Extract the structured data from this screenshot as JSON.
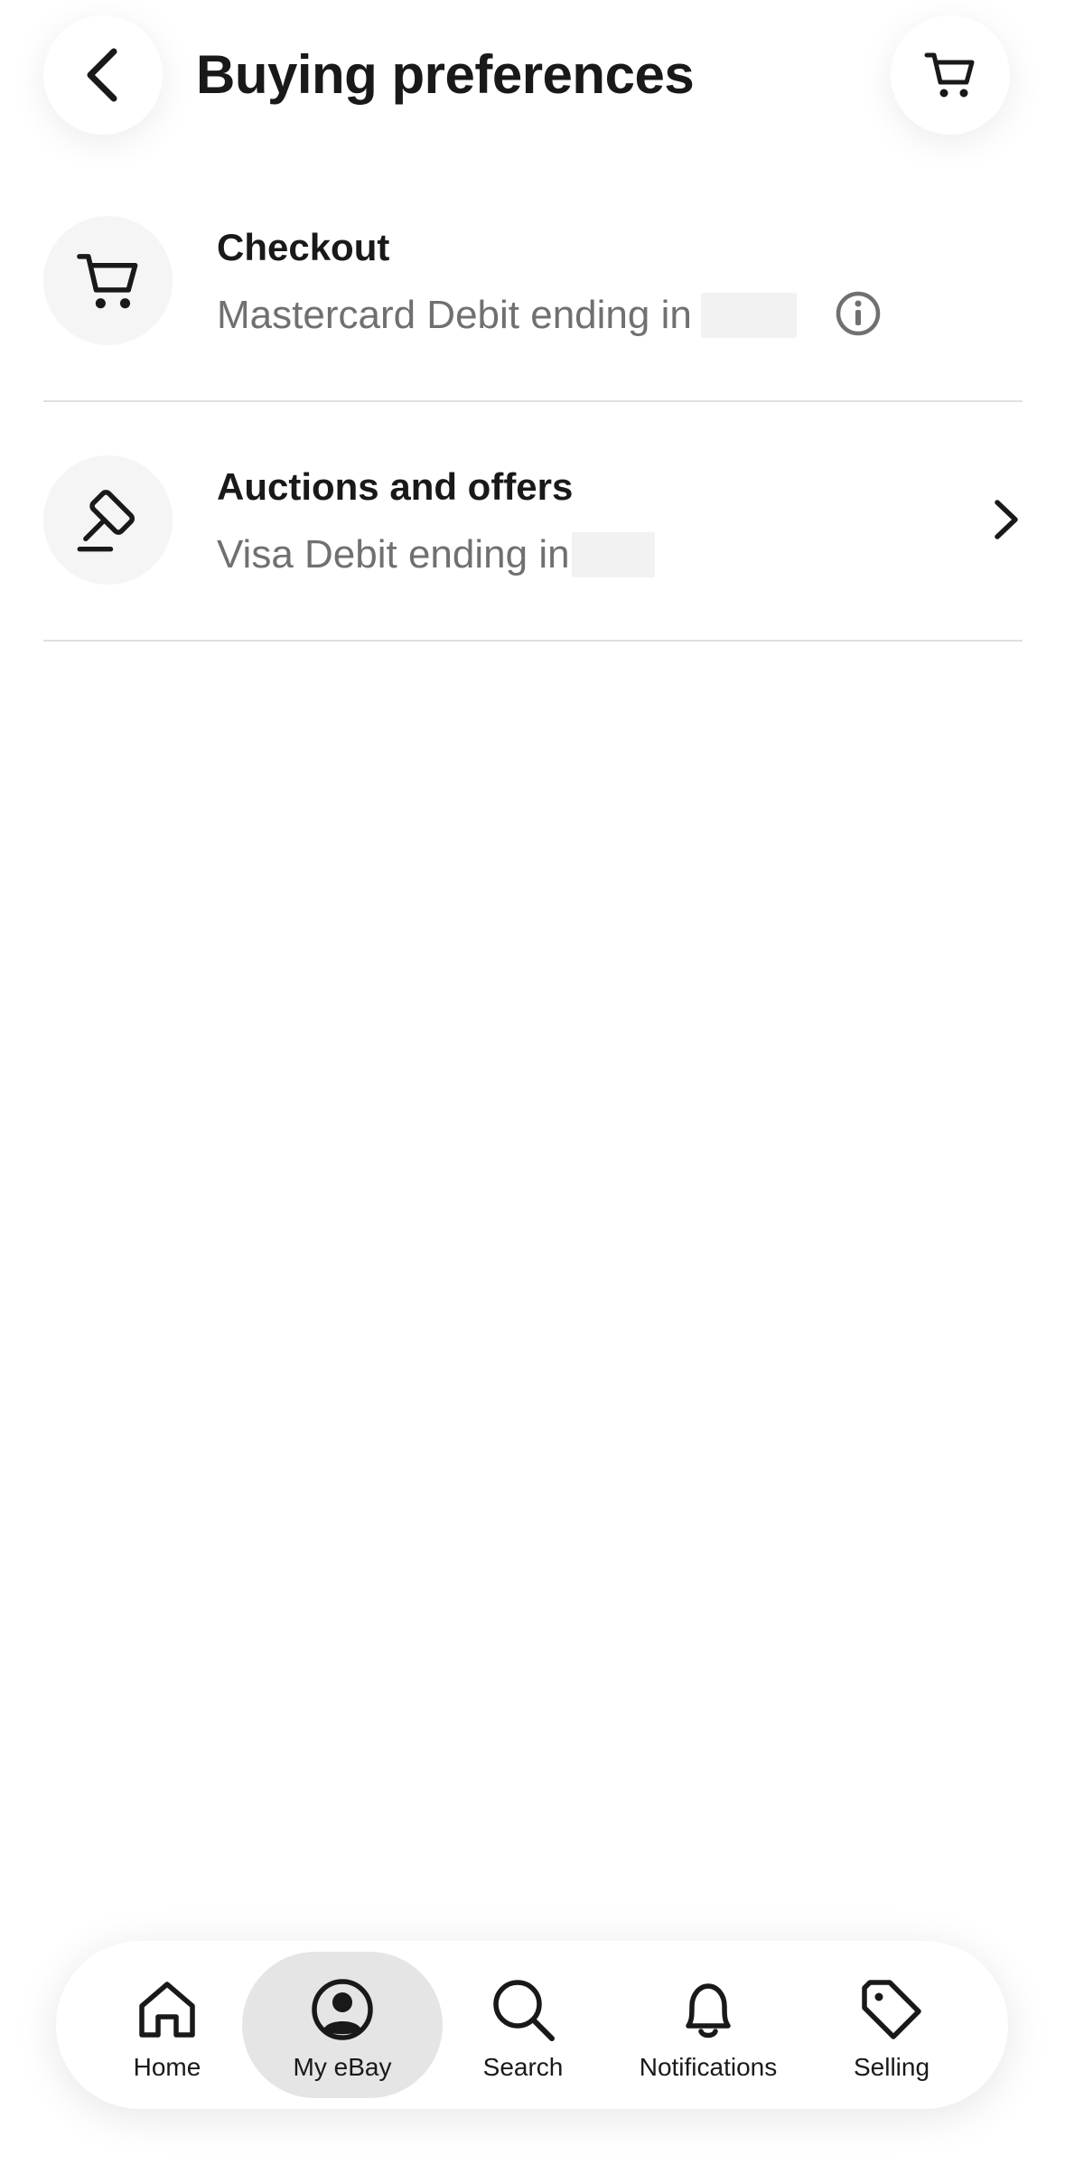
{
  "header": {
    "title": "Buying preferences",
    "back_icon": "chevron-left-icon",
    "cart_icon": "cart-icon"
  },
  "rows": [
    {
      "title": "Checkout",
      "subtitle": "Mastercard Debit ending in",
      "icon": "cart-icon",
      "trailing_icon": "info-icon"
    },
    {
      "title": "Auctions and offers",
      "subtitle": "Visa Debit ending in",
      "icon": "gavel-icon",
      "trailing_icon": "chevron-right-icon"
    }
  ],
  "bottom_nav": {
    "items": [
      {
        "label": "Home",
        "icon": "home-icon",
        "selected": false
      },
      {
        "label": "My eBay",
        "icon": "user-icon",
        "selected": true
      },
      {
        "label": "Search",
        "icon": "search-icon",
        "selected": false
      },
      {
        "label": "Notifications",
        "icon": "bell-icon",
        "selected": false
      },
      {
        "label": "Selling",
        "icon": "tag-icon",
        "selected": false
      }
    ]
  },
  "colors": {
    "text_primary": "#191919",
    "text_secondary": "#707070",
    "divider": "#e0e0e0",
    "icon_bg": "#f4f5f4",
    "nav_selected_bg": "#e5e5e5"
  }
}
